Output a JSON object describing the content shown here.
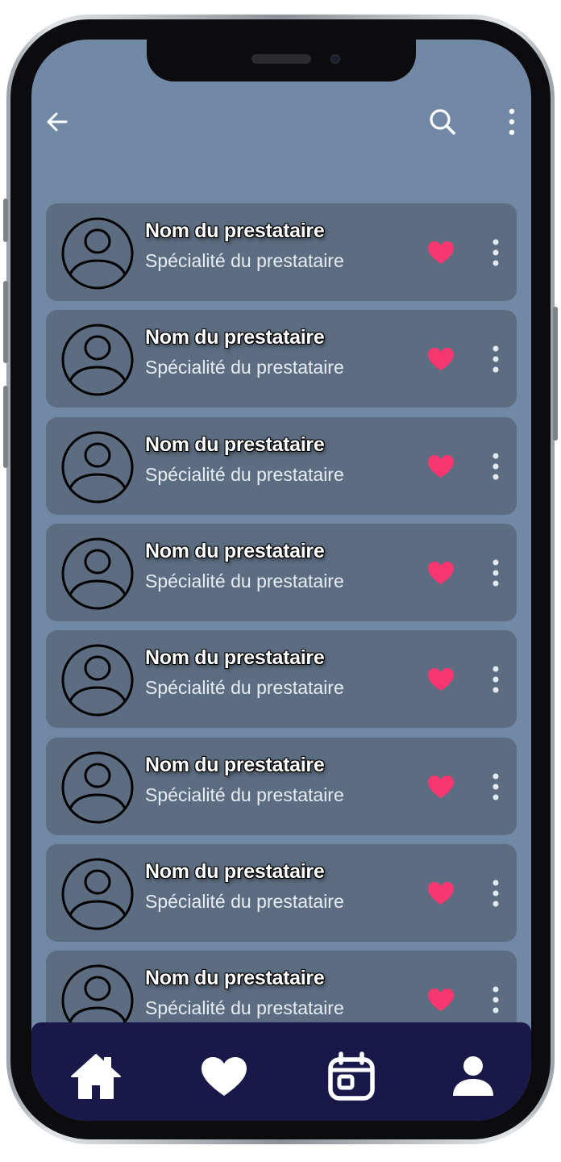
{
  "topbar": {
    "back_icon": "arrow-left-icon",
    "search_icon": "search-icon",
    "menu_icon": "more-vertical-icon"
  },
  "providers": [
    {
      "name": "Nom du prestataire",
      "specialty": "Spécialité du prestataire",
      "favorite": true
    },
    {
      "name": "Nom du prestataire",
      "specialty": "Spécialité du prestataire",
      "favorite": true
    },
    {
      "name": "Nom du prestataire",
      "specialty": "Spécialité du prestataire",
      "favorite": true
    },
    {
      "name": "Nom du prestataire",
      "specialty": "Spécialité du prestataire",
      "favorite": true
    },
    {
      "name": "Nom du prestataire",
      "specialty": "Spécialité du prestataire",
      "favorite": true
    },
    {
      "name": "Nom du prestataire",
      "specialty": "Spécialité du prestataire",
      "favorite": true
    },
    {
      "name": "Nom du prestataire",
      "specialty": "Spécialité du prestataire",
      "favorite": true
    },
    {
      "name": "Nom du prestataire",
      "specialty": "Spécialité du prestataire",
      "favorite": true
    }
  ],
  "bottom_nav": [
    {
      "icon": "home-icon"
    },
    {
      "icon": "heart-icon"
    },
    {
      "icon": "calendar-icon"
    },
    {
      "icon": "profile-icon"
    }
  ],
  "colors": {
    "screen_background": "#7289a6",
    "card_background": "#5c6d81",
    "favorite_heart": "#f7376f",
    "bottom_nav_background": "#1a1849",
    "text_primary": "#ffffff"
  }
}
